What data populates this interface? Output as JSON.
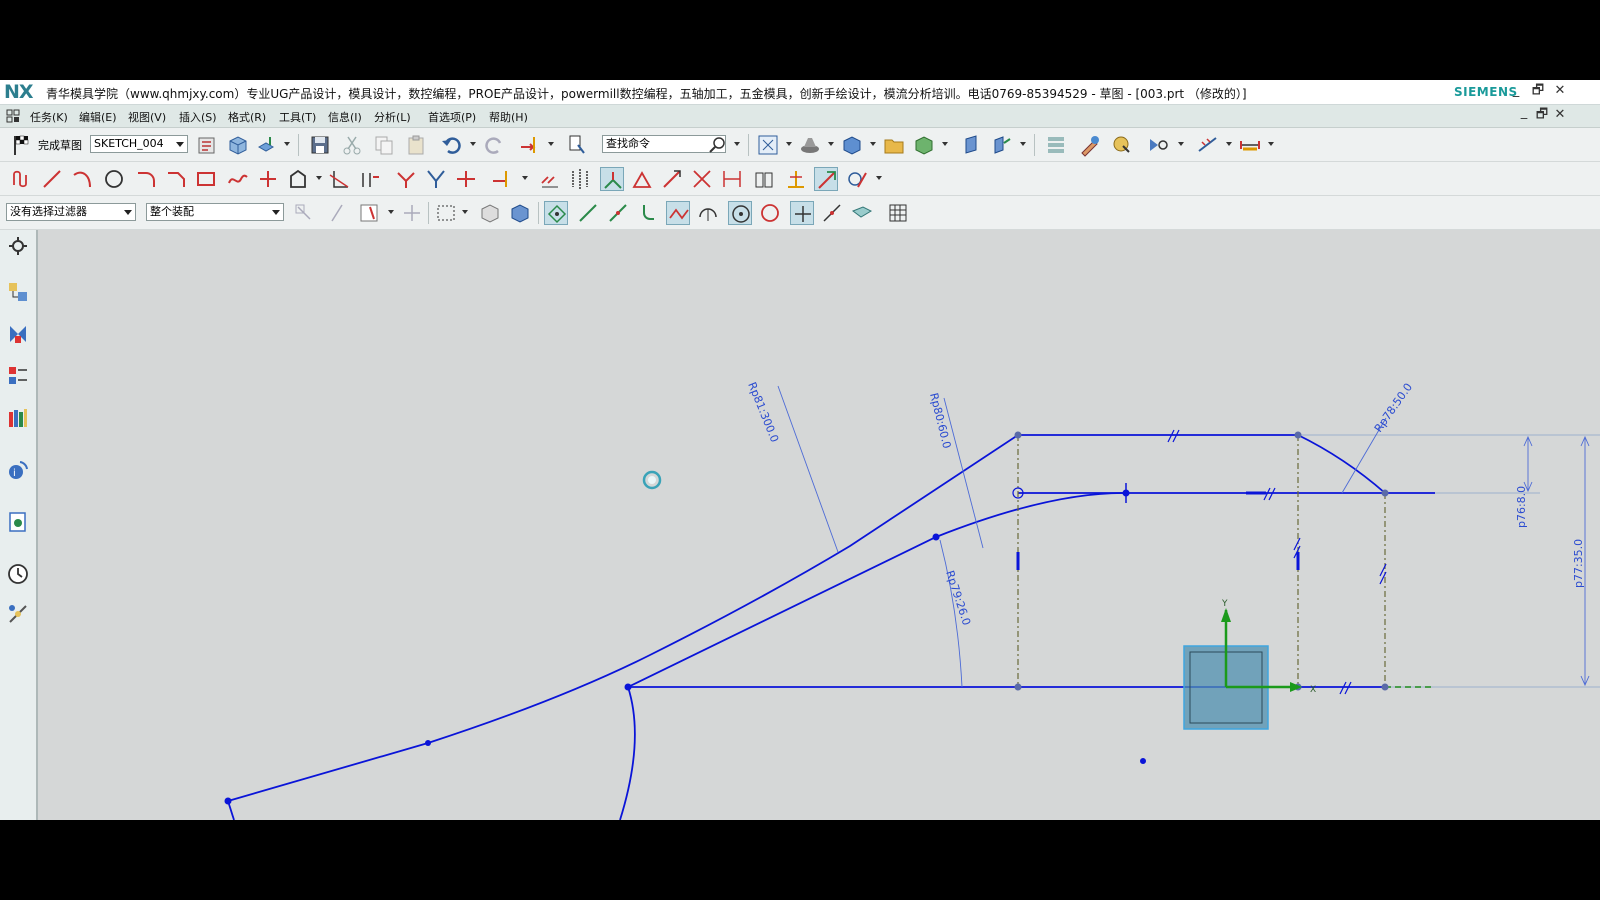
{
  "window": {
    "logo": "NX",
    "title": "青华模具学院（www.qhmjxy.com）专业UG产品设计，模具设计，数控编程，PROE产品设计，powermill数控编程，五轴加工，五金模具，创新手绘设计，模流分析培训。电话0769-85394529 - 草图 - [003.prt （修改的）]",
    "brand": "SIEMENS",
    "minimize": "_",
    "restore": "🗗",
    "close": "✕"
  },
  "menu": {
    "items": [
      "任务(K)",
      "编辑(E)",
      "视图(V)",
      "插入(S)",
      "格式(R)",
      "工具(T)",
      "信息(I)",
      "分析(L)",
      "首选项(P)",
      "帮助(H)"
    ],
    "doc_minimize": "_",
    "doc_restore": "🗗",
    "doc_close": "✕"
  },
  "toolbar1": {
    "finish_sketch_label": "完成草图",
    "sketch_name": "SKETCH_004",
    "search_placeholder": "查找命令"
  },
  "toolbar3": {
    "selection_filter": "没有选择过滤器",
    "scope": "整个装配"
  },
  "dimensions": {
    "d1": "Rp81:300.0",
    "d2": "Rp80:60.0",
    "d3": "Rp78:50.0",
    "d4": "Rp79:26.0",
    "d5": "p76:8.0",
    "d6": "p77:35.0"
  },
  "csys": {
    "x_label": "X",
    "y_label": "Y"
  },
  "colors": {
    "curve": "#0a14d8",
    "dimension": "#2a4bd0",
    "background": "#d5d7d7",
    "accent": "#2c7e8e"
  }
}
